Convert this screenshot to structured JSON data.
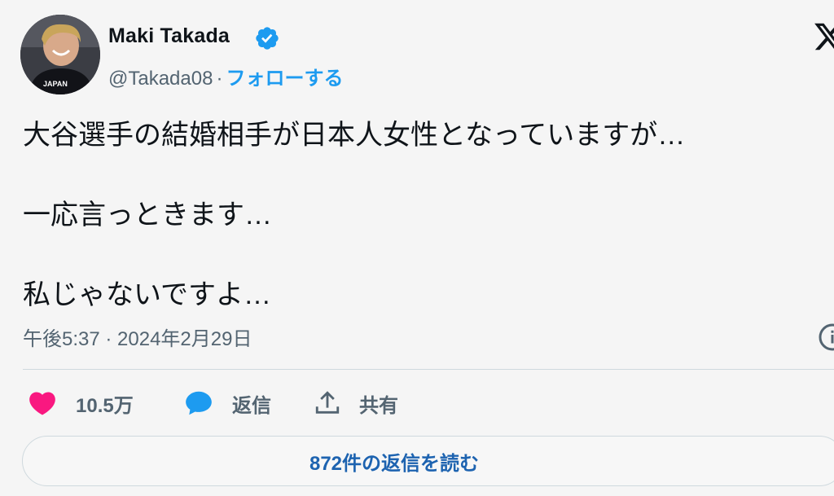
{
  "author": {
    "display_name": "Maki Takada",
    "handle": "@Takada08",
    "separator": "·",
    "follow_label": "フォローする",
    "jersey_text": "JAPAN"
  },
  "tweet": {
    "lines": [
      "大谷選手の結婚相手が日本人女性となっていますが…",
      "一応言っときます…",
      "私じゃないですよ…"
    ],
    "timestamp": "午後5:37 · 2024年2月29日"
  },
  "actions": {
    "like_count": "10.5万",
    "reply_label": "返信",
    "share_label": "共有"
  },
  "read_replies_label": "872件の返信を読む",
  "colors": {
    "accent": "#1d9bf0",
    "like": "#f91880",
    "muted": "#536471",
    "reply_link": "#1d63b0"
  }
}
